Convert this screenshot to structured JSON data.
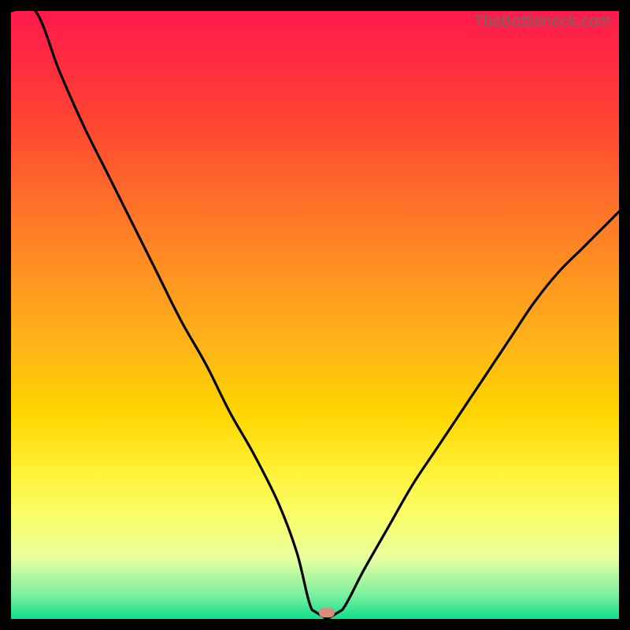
{
  "watermark": "TheBottleneck.com",
  "colors": {
    "curve": "#000000",
    "marker": "#d98c7a",
    "frame": "#000000"
  },
  "chart_data": {
    "type": "line",
    "title": "",
    "xlabel": "",
    "ylabel": "",
    "xlim": [
      0,
      100
    ],
    "ylim": [
      0,
      100
    ],
    "marker_x": 52,
    "marker_y": 0,
    "flat_plateau": [
      49.5,
      54.5
    ],
    "series": [
      {
        "name": "bottleneck-curve",
        "x": [
          0,
          4,
          8,
          12,
          16,
          20,
          24,
          28,
          32,
          36,
          40,
          44,
          47,
          49.5,
          52,
          54.5,
          58,
          62,
          66,
          70,
          74,
          78,
          82,
          86,
          90,
          94,
          98,
          100
        ],
        "y": [
          115,
          100,
          90,
          81,
          73,
          65,
          57,
          49,
          42,
          34,
          27,
          19,
          11,
          1.5,
          0,
          1.5,
          8,
          15,
          22,
          28,
          34,
          40,
          46,
          52,
          57,
          61,
          65,
          67
        ]
      }
    ]
  }
}
